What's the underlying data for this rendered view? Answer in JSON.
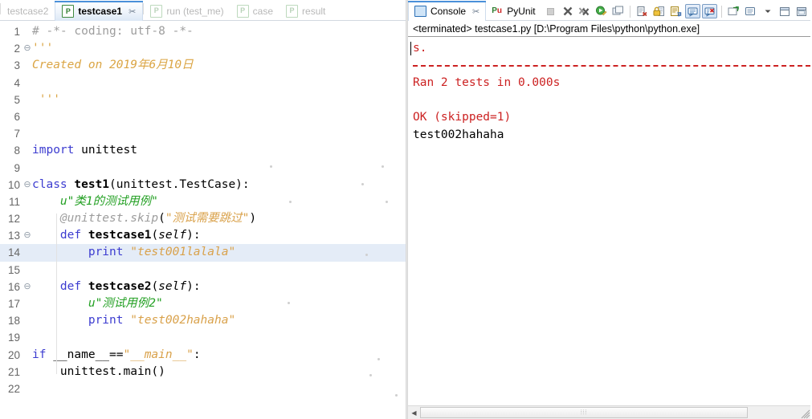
{
  "editor": {
    "tabs": [
      {
        "label": "testcase2",
        "icon": "python-file-icon",
        "active": false,
        "closable": false
      },
      {
        "label": "testcase1",
        "icon": "python-file-icon",
        "active": true,
        "closable": true
      },
      {
        "label": "run (test_me)",
        "icon": "python-file-icon",
        "active": false,
        "closable": false
      },
      {
        "label": "case",
        "icon": "python-file-icon",
        "active": false,
        "closable": false
      },
      {
        "label": "result",
        "icon": "python-file-icon",
        "active": false,
        "closable": false
      }
    ],
    "close_glyph": "✂",
    "highlighted_line": 14,
    "fold_lines": [
      2,
      10,
      13,
      16
    ],
    "fold_glyph": "⊖",
    "line_numbers": [
      1,
      2,
      3,
      4,
      5,
      6,
      7,
      8,
      9,
      10,
      11,
      12,
      13,
      14,
      15,
      16,
      17,
      18,
      19,
      20,
      21,
      22
    ],
    "lines": [
      {
        "n": 1,
        "tokens": [
          {
            "t": "# -*- coding: utf-8 -*-",
            "c": "t-comment"
          }
        ]
      },
      {
        "n": 2,
        "tokens": [
          {
            "t": "'''",
            "c": "t-doc"
          }
        ]
      },
      {
        "n": 3,
        "tokens": [
          {
            "t": "Created on 2019年6月10日",
            "c": "t-doc"
          }
        ]
      },
      {
        "n": 4,
        "tokens": []
      },
      {
        "n": 5,
        "tokens": [
          {
            "t": " '''",
            "c": "t-doc"
          }
        ]
      },
      {
        "n": 6,
        "tokens": []
      },
      {
        "n": 7,
        "tokens": []
      },
      {
        "n": 8,
        "tokens": [
          {
            "t": "import",
            "c": "t-kw"
          },
          {
            "t": " unittest",
            "c": "t-plain"
          }
        ]
      },
      {
        "n": 9,
        "tokens": []
      },
      {
        "n": 10,
        "tokens": [
          {
            "t": "class",
            "c": "t-kw"
          },
          {
            "t": " ",
            "c": "t-plain"
          },
          {
            "t": "test1",
            "c": "t-def"
          },
          {
            "t": "(unittest.TestCase):",
            "c": "t-plain"
          }
        ]
      },
      {
        "n": 11,
        "tokens": [
          {
            "t": "    u\"类1的测试用例\"",
            "c": "t-green"
          }
        ]
      },
      {
        "n": 12,
        "tokens": [
          {
            "t": "    @unittest.skip",
            "c": "t-dec"
          },
          {
            "t": "(",
            "c": "t-plain"
          },
          {
            "t": "\"测试需要跳过\"",
            "c": "t-str"
          },
          {
            "t": ")",
            "c": "t-plain"
          }
        ]
      },
      {
        "n": 13,
        "tokens": [
          {
            "t": "    ",
            "c": "t-plain"
          },
          {
            "t": "def",
            "c": "t-kw"
          },
          {
            "t": " ",
            "c": "t-plain"
          },
          {
            "t": "testcase1",
            "c": "t-def"
          },
          {
            "t": "(",
            "c": "t-plain"
          },
          {
            "t": "self",
            "c": "t-self"
          },
          {
            "t": "):",
            "c": "t-plain"
          }
        ]
      },
      {
        "n": 14,
        "tokens": [
          {
            "t": "        ",
            "c": "t-plain"
          },
          {
            "t": "print",
            "c": "t-kw"
          },
          {
            "t": " ",
            "c": "t-plain"
          },
          {
            "t": "\"test001lalala\"",
            "c": "t-str"
          }
        ]
      },
      {
        "n": 15,
        "tokens": []
      },
      {
        "n": 16,
        "tokens": [
          {
            "t": "    ",
            "c": "t-plain"
          },
          {
            "t": "def",
            "c": "t-kw"
          },
          {
            "t": " ",
            "c": "t-plain"
          },
          {
            "t": "testcase2",
            "c": "t-def"
          },
          {
            "t": "(",
            "c": "t-plain"
          },
          {
            "t": "self",
            "c": "t-self"
          },
          {
            "t": "):",
            "c": "t-plain"
          }
        ]
      },
      {
        "n": 17,
        "tokens": [
          {
            "t": "        u\"测试用例2\"",
            "c": "t-green"
          }
        ]
      },
      {
        "n": 18,
        "tokens": [
          {
            "t": "        ",
            "c": "t-plain"
          },
          {
            "t": "print",
            "c": "t-kw"
          },
          {
            "t": " ",
            "c": "t-plain"
          },
          {
            "t": "\"test002hahaha\"",
            "c": "t-str"
          }
        ]
      },
      {
        "n": 19,
        "tokens": []
      },
      {
        "n": 20,
        "tokens": [
          {
            "t": "if",
            "c": "t-kw"
          },
          {
            "t": " __name__==",
            "c": "t-plain"
          },
          {
            "t": "\"",
            "c": "t-str-p"
          },
          {
            "t": "__main__",
            "c": "t-str"
          },
          {
            "t": "\"",
            "c": "t-str-p"
          },
          {
            "t": ":",
            "c": "t-plain"
          }
        ]
      },
      {
        "n": 21,
        "tokens": [
          {
            "t": "    unittest.main()",
            "c": "t-plain"
          }
        ]
      },
      {
        "n": 22,
        "tokens": []
      }
    ]
  },
  "console": {
    "tabs": [
      {
        "label": "Console",
        "icon": "monitor-icon",
        "active": true,
        "closable": true
      },
      {
        "label": "PyUnit",
        "icon": "pyunit-icon",
        "active": false,
        "closable": false
      }
    ],
    "close_glyph": "✂",
    "toolbar": [
      {
        "name": "terminate-button",
        "enabled": false
      },
      {
        "name": "remove-launch-button",
        "enabled": true
      },
      {
        "name": "remove-all-terminated-button",
        "enabled": true
      },
      {
        "name": "relaunch-button",
        "enabled": true
      },
      {
        "name": "new-console-view-button",
        "enabled": true
      },
      {
        "name": "clear-console-button",
        "enabled": true
      },
      {
        "name": "scroll-lock-button",
        "enabled": true
      },
      {
        "name": "word-wrap-button",
        "enabled": true
      },
      {
        "name": "show-console-on-output-button",
        "enabled": true,
        "pressed": true
      },
      {
        "name": "show-console-on-error-button",
        "enabled": true,
        "pressed": true
      },
      {
        "name": "pin-console-button",
        "enabled": true
      },
      {
        "name": "display-selected-console-button",
        "enabled": true
      },
      {
        "name": "open-console-button",
        "enabled": true
      },
      {
        "name": "view-menu-button",
        "enabled": true
      },
      {
        "name": "minimize-button",
        "enabled": true
      },
      {
        "name": "maximize-button",
        "enabled": true
      }
    ],
    "header": "<terminated> testcase1.py [D:\\Program Files\\python\\python.exe]",
    "output": [
      {
        "text": "s.",
        "color": "red",
        "caret": true
      },
      {
        "text": "",
        "color": "red",
        "rule": true
      },
      {
        "text": "Ran 2 tests in 0.000s",
        "color": "red"
      },
      {
        "text": "",
        "color": "red"
      },
      {
        "text": "OK (skipped=1)",
        "color": "red"
      },
      {
        "text": "test002hahaha",
        "color": "black"
      }
    ],
    "scrollbar": {
      "grip": "⦙⦙⦙"
    }
  },
  "colors": {
    "keyword": "#3c3cd0",
    "string": "#d9a14a",
    "comment": "#9d9d9d",
    "docstring_green": "#23a023",
    "console_error": "#cc2222",
    "highlight_line": "#e4ecf7",
    "tab_accent": "#4a90d9"
  }
}
